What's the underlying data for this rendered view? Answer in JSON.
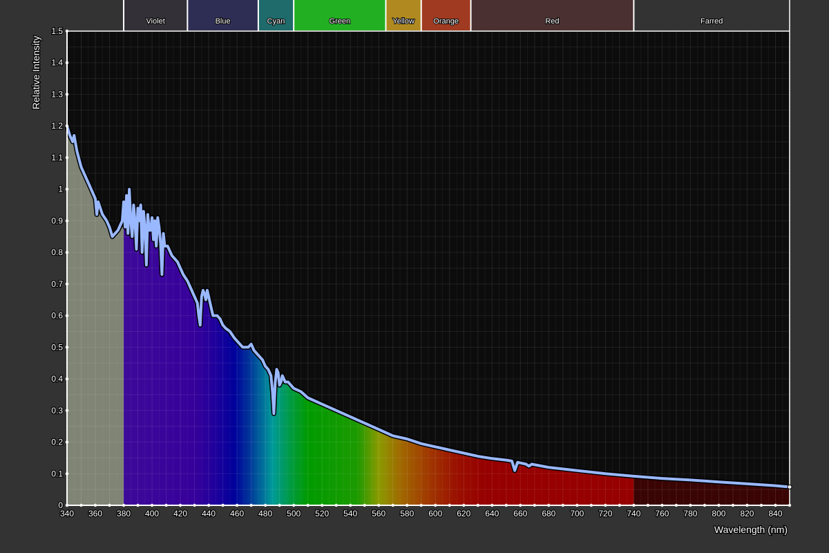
{
  "chart_data": {
    "type": "area",
    "title": "",
    "xlabel": "Wavelength (nm)",
    "ylabel": "Relative Intensity",
    "xlim": [
      340,
      850
    ],
    "ylim": [
      0,
      1.5
    ],
    "x_ticks": [
      340,
      360,
      380,
      400,
      420,
      440,
      460,
      480,
      500,
      520,
      540,
      560,
      580,
      600,
      620,
      640,
      660,
      680,
      700,
      720,
      740,
      760,
      780,
      800,
      820,
      840
    ],
    "y_ticks": [
      0,
      0.1,
      0.2,
      0.3,
      0.4,
      0.5,
      0.6,
      0.7,
      0.8,
      0.9,
      1,
      1.1,
      1.2,
      1.3,
      1.4,
      1.5
    ],
    "y_tick_labels": [
      "0",
      "0.1",
      "0.2",
      "0.3",
      "0.4",
      "0.5",
      "0.6",
      "0.7",
      "0.8",
      "0.9",
      "1",
      "1.1",
      "1.2",
      "1.3",
      "1.4",
      "1.5"
    ],
    "grid": true,
    "bands": [
      {
        "name": "Violet",
        "start": 380,
        "end": 425,
        "color": "#333038"
      },
      {
        "name": "Blue",
        "start": 425,
        "end": 475,
        "color": "#2e2e55"
      },
      {
        "name": "Cyan",
        "start": 475,
        "end": 500,
        "color": "#1f6a6a"
      },
      {
        "name": "Green",
        "start": 500,
        "end": 565,
        "color": "#22b022"
      },
      {
        "name": "Yellow",
        "start": 565,
        "end": 590,
        "color": "#b08a20"
      },
      {
        "name": "Orange",
        "start": 590,
        "end": 625,
        "color": "#a03a20"
      },
      {
        "name": "Red",
        "start": 625,
        "end": 740,
        "color": "#4a3030"
      },
      {
        "name": "Farred",
        "start": 740,
        "end": 850,
        "color": "#333333"
      }
    ],
    "spectrum_fill": [
      [
        340,
        "#7f8475"
      ],
      [
        379.9,
        "#7f8475"
      ],
      [
        380,
        "#3c0a99"
      ],
      [
        430,
        "#36009a"
      ],
      [
        445,
        "#1e009c"
      ],
      [
        458,
        "#00009a"
      ],
      [
        470,
        "#003c9a"
      ],
      [
        485,
        "#009a9a"
      ],
      [
        498,
        "#009a40"
      ],
      [
        510,
        "#009a00"
      ],
      [
        545,
        "#1c9a00"
      ],
      [
        560,
        "#8a9a00"
      ],
      [
        575,
        "#a06a00"
      ],
      [
        595,
        "#a03800"
      ],
      [
        615,
        "#9a1000"
      ],
      [
        635,
        "#960000"
      ],
      [
        739.9,
        "#960000"
      ],
      [
        740,
        "#3a0404"
      ],
      [
        850,
        "#3a0404"
      ]
    ],
    "series": [
      {
        "name": "Relative Intensity",
        "color": "#9ab8ff",
        "x": [
          340,
          342,
          344,
          345,
          347,
          350,
          353,
          355,
          358,
          360,
          361,
          362,
          365,
          368,
          370,
          372,
          374,
          376,
          378,
          379,
          380,
          381,
          382,
          383,
          384,
          385,
          386,
          387,
          388,
          389,
          390,
          391,
          392,
          393,
          394,
          395,
          396,
          397,
          398,
          399,
          400,
          401,
          402,
          403,
          404,
          405,
          406,
          407,
          408,
          409,
          410,
          411,
          412,
          414,
          416,
          418,
          420,
          422,
          425,
          428,
          430,
          432,
          433,
          434,
          435,
          436,
          437,
          438,
          439,
          440,
          441,
          442,
          443,
          444,
          446,
          448,
          450,
          452,
          455,
          458,
          460,
          462,
          464,
          466,
          468,
          470,
          472,
          474,
          476,
          478,
          480,
          482,
          484,
          485,
          486,
          487,
          488,
          489,
          490,
          491,
          492,
          494,
          496,
          498,
          500,
          505,
          510,
          520,
          530,
          540,
          550,
          560,
          570,
          580,
          590,
          600,
          610,
          620,
          630,
          640,
          650,
          654,
          656,
          658,
          660,
          664,
          666,
          668,
          680,
          700,
          720,
          740,
          760,
          780,
          800,
          820,
          840,
          850
        ],
        "y": [
          1.2,
          1.17,
          1.15,
          1.17,
          1.12,
          1.07,
          1.04,
          1.02,
          0.99,
          0.97,
          0.92,
          0.96,
          0.92,
          0.9,
          0.88,
          0.85,
          0.86,
          0.87,
          0.89,
          0.9,
          0.96,
          0.88,
          0.98,
          0.86,
          1.0,
          0.9,
          0.85,
          0.95,
          0.9,
          0.81,
          0.94,
          0.9,
          0.95,
          0.8,
          0.93,
          0.88,
          0.76,
          0.92,
          0.87,
          0.87,
          0.91,
          0.84,
          0.9,
          0.82,
          0.91,
          0.88,
          0.83,
          0.73,
          0.86,
          0.82,
          0.82,
          0.82,
          0.81,
          0.79,
          0.78,
          0.77,
          0.75,
          0.73,
          0.71,
          0.68,
          0.66,
          0.64,
          0.6,
          0.57,
          0.66,
          0.68,
          0.67,
          0.65,
          0.68,
          0.66,
          0.64,
          0.62,
          0.6,
          0.6,
          0.6,
          0.59,
          0.57,
          0.56,
          0.55,
          0.53,
          0.52,
          0.51,
          0.5,
          0.5,
          0.5,
          0.51,
          0.49,
          0.48,
          0.47,
          0.46,
          0.44,
          0.43,
          0.41,
          0.36,
          0.29,
          0.39,
          0.43,
          0.42,
          0.38,
          0.39,
          0.41,
          0.39,
          0.39,
          0.38,
          0.37,
          0.36,
          0.34,
          0.32,
          0.3,
          0.28,
          0.26,
          0.24,
          0.22,
          0.21,
          0.195,
          0.185,
          0.175,
          0.165,
          0.155,
          0.148,
          0.143,
          0.14,
          0.11,
          0.136,
          0.134,
          0.13,
          0.124,
          0.13,
          0.12,
          0.11,
          0.1,
          0.092,
          0.085,
          0.08,
          0.074,
          0.068,
          0.062,
          0.058
        ]
      }
    ]
  }
}
